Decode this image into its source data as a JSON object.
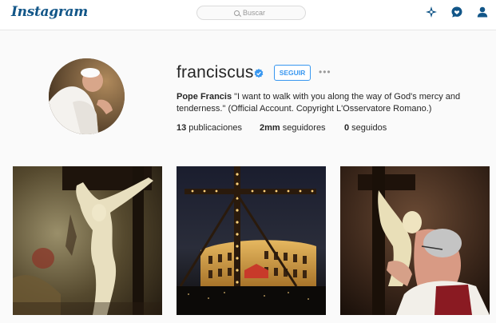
{
  "header": {
    "logo": "Instagram",
    "search_placeholder": "Buscar",
    "icons": [
      "explore-icon",
      "activity-icon",
      "profile-icon"
    ]
  },
  "profile": {
    "username": "franciscus",
    "verified": true,
    "follow_label": "SEGUIR",
    "more_label": "•••",
    "bio_name": "Pope Francis",
    "bio_text": " \"I want to walk with you along the way of God's mercy and tenderness.\" (Official Account. Copyright L'Osservatore Romano.)",
    "stats": [
      {
        "count": "13",
        "label": " publicaciones"
      },
      {
        "count": "2mm",
        "label": " seguidores"
      },
      {
        "count": "0",
        "label": " seguidos"
      }
    ]
  },
  "posts": [
    {
      "subject": "crucifix"
    },
    {
      "subject": "colosseum-via-crucis"
    },
    {
      "subject": "pope-kissing-crucifix"
    }
  ],
  "colors": {
    "accent": "#3897f0",
    "logo": "#125688",
    "background": "#fafafa"
  }
}
